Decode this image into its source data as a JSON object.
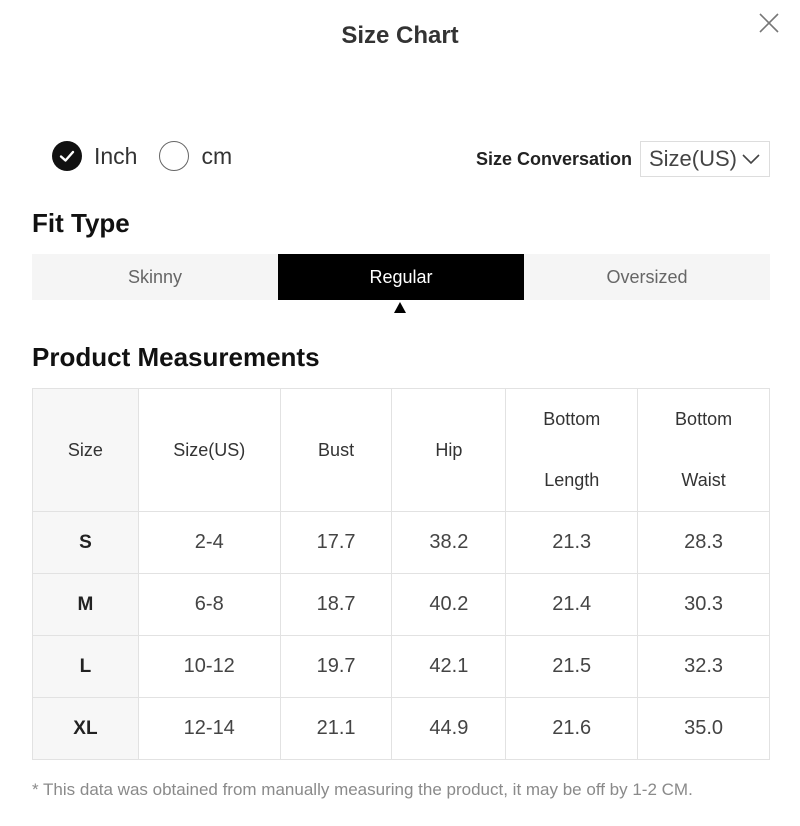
{
  "dialog": {
    "title": "Size Chart",
    "close_icon": "close-icon"
  },
  "units": {
    "options": [
      {
        "label": "Inch",
        "selected": true
      },
      {
        "label": "cm",
        "selected": false
      }
    ]
  },
  "conversion": {
    "label": "Size Conversation",
    "selected": "Size(US)"
  },
  "fit_type": {
    "title": "Fit Type",
    "tabs": [
      {
        "label": "Skinny",
        "active": false
      },
      {
        "label": "Regular",
        "active": true
      },
      {
        "label": "Oversized",
        "active": false
      }
    ]
  },
  "measurements": {
    "title": "Product Measurements",
    "headers": [
      "Size",
      "Size(US)",
      "Bust",
      "Hip",
      [
        "Bottom",
        "Length"
      ],
      [
        "Bottom",
        "Waist"
      ]
    ],
    "rows": [
      [
        "S",
        "2-4",
        "17.7",
        "38.2",
        "21.3",
        "28.3"
      ],
      [
        "M",
        "6-8",
        "18.7",
        "40.2",
        "21.4",
        "30.3"
      ],
      [
        "L",
        "10-12",
        "19.7",
        "42.1",
        "21.5",
        "32.3"
      ],
      [
        "XL",
        "12-14",
        "21.1",
        "44.9",
        "21.6",
        "35.0"
      ]
    ]
  },
  "note": "* This data was obtained from manually measuring the product, it may be off by 1-2 CM.",
  "colors": {
    "active_tab": "#000000",
    "tab_bg": "#f5f5f5",
    "border": "#e2e2e2"
  }
}
